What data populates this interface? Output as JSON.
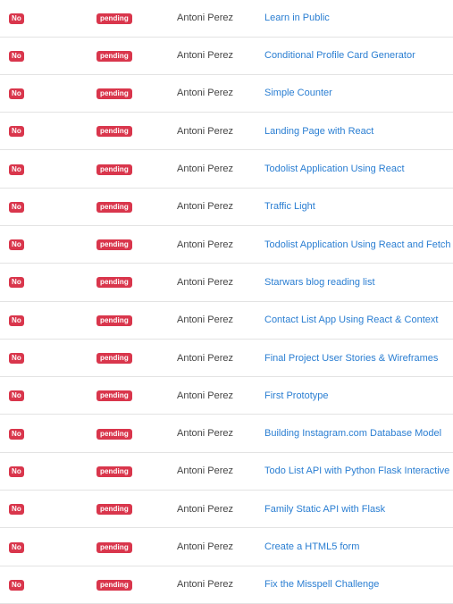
{
  "colors": {
    "badge_bg": "#d9364c",
    "link": "#2a7ed2",
    "divider": "#e3e3e3"
  },
  "rows": [
    {
      "delivered": "No",
      "status": "pending",
      "student": "Antoni Perez",
      "project": "Learn in Public"
    },
    {
      "delivered": "No",
      "status": "pending",
      "student": "Antoni Perez",
      "project": "Conditional Profile Card Generator"
    },
    {
      "delivered": "No",
      "status": "pending",
      "student": "Antoni Perez",
      "project": "Simple Counter"
    },
    {
      "delivered": "No",
      "status": "pending",
      "student": "Antoni Perez",
      "project": "Landing Page with React"
    },
    {
      "delivered": "No",
      "status": "pending",
      "student": "Antoni Perez",
      "project": "Todolist Application Using React"
    },
    {
      "delivered": "No",
      "status": "pending",
      "student": "Antoni Perez",
      "project": "Traffic Light"
    },
    {
      "delivered": "No",
      "status": "pending",
      "student": "Antoni Perez",
      "project": "Todolist Application Using React and Fetch"
    },
    {
      "delivered": "No",
      "status": "pending",
      "student": "Antoni Perez",
      "project": "Starwars blog reading list"
    },
    {
      "delivered": "No",
      "status": "pending",
      "student": "Antoni Perez",
      "project": "Contact List App Using React & Context"
    },
    {
      "delivered": "No",
      "status": "pending",
      "student": "Antoni Perez",
      "project": "Final Project User Stories & Wireframes"
    },
    {
      "delivered": "No",
      "status": "pending",
      "student": "Antoni Perez",
      "project": "First Prototype"
    },
    {
      "delivered": "No",
      "status": "pending",
      "student": "Antoni Perez",
      "project": "Building Instagram.com Database Model"
    },
    {
      "delivered": "No",
      "status": "pending",
      "student": "Antoni Perez",
      "project": "Todo List API with Python Flask Interactive"
    },
    {
      "delivered": "No",
      "status": "pending",
      "student": "Antoni Perez",
      "project": "Family Static API with Flask"
    },
    {
      "delivered": "No",
      "status": "pending",
      "student": "Antoni Perez",
      "project": "Create a HTML5 form"
    },
    {
      "delivered": "No",
      "status": "pending",
      "student": "Antoni Perez",
      "project": "Fix the Misspell Challenge"
    }
  ]
}
